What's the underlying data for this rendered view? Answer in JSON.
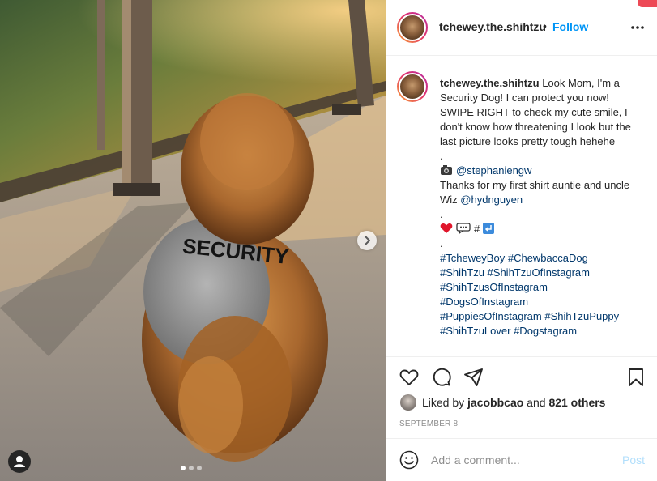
{
  "post": {
    "username": "tchewey.the.shihtzu",
    "bullet": "•",
    "follow_label": "Follow",
    "more_icon": "more-horizontal-icon"
  },
  "image": {
    "shirt_text": "SECURITY",
    "carousel_total": 3,
    "carousel_active": 1,
    "colors": {
      "sunlight": "#f2b25b",
      "fur": "#b7793d",
      "shirt": "#8f8f8f",
      "carpet": "#a39c95"
    }
  },
  "caption": {
    "username": "tchewey.the.shihtzu",
    "text_1": "Look Mom, I'm a Security Dog! I can protect you now! SWIPE RIGHT to check my cute smile, I don't know how threatening I look but the last picture looks pretty tough hehehe",
    "dot_1": ".",
    "camera_mention": "@stephaniengw",
    "thanks_text": "Thanks for my first shirt auntie and uncle Wiz ",
    "thanks_mention": "@hydnguyen",
    "dot_2": ".",
    "hash_symbol": "#",
    "dot_3": ".",
    "hashtags": [
      "#TcheweyBoy",
      "#ChewbaccaDog",
      "#ShihTzu",
      "#ShihTzuOfInstagram",
      "#ShihTzusOfInstagram",
      "#DogsOfInstagram",
      "#PuppiesOfInstagram",
      "#ShihTzuPuppy",
      "#ShihTzuLover",
      "#Dogstagram"
    ]
  },
  "likes": {
    "prefix": "Liked by ",
    "user": "jacobbcao",
    "middle": " and ",
    "others": "821 others"
  },
  "date": "SEPTEMBER 8",
  "comment": {
    "placeholder": "Add a comment...",
    "post_label": "Post"
  },
  "colors": {
    "link_blue": "#0095f6",
    "mention": "#00376b",
    "muted": "#8e8e8e",
    "post_disabled": "#b2dffc",
    "notification_red": "#ed4956"
  }
}
